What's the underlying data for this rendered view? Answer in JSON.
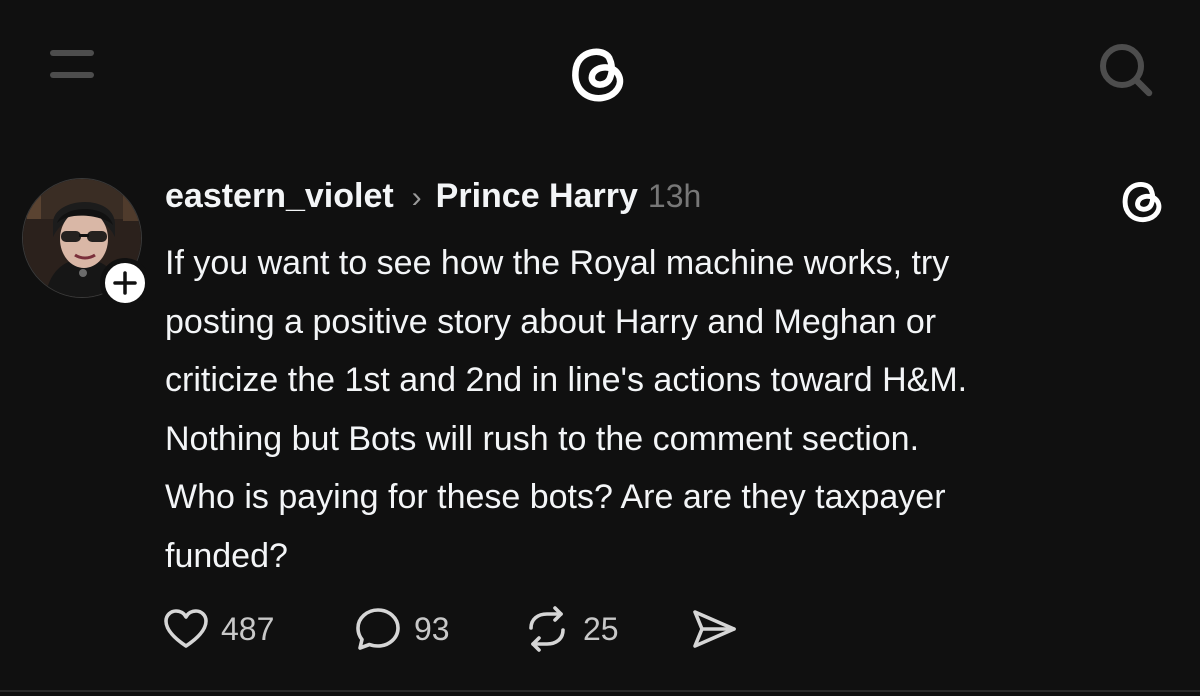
{
  "app": {
    "name": "Threads"
  },
  "icons": {
    "menu": "menu-icon",
    "logo": "threads-logo-icon",
    "search": "search-icon",
    "like": "heart-icon",
    "reply": "comment-icon",
    "repost": "repost-icon",
    "share": "send-icon",
    "follow": "plus-icon"
  },
  "colors": {
    "background": "#101010",
    "text": "#f3f5f7",
    "secondary": "#777777",
    "icon_muted": "#4d4d4d"
  },
  "post": {
    "author": "eastern_violet",
    "separator": "›",
    "topic": "Prince Harry",
    "time": "13h",
    "text": "If you want to see how the Royal machine works, try\nposting a positive story about Harry and Meghan or\ncriticize the 1st and 2nd in line's actions toward H&M.\nNothing but Bots will rush to the comment section.\nWho is paying for these bots? Are are they taxpayer\nfunded?",
    "likes": "487",
    "replies": "93",
    "reposts": "25"
  }
}
